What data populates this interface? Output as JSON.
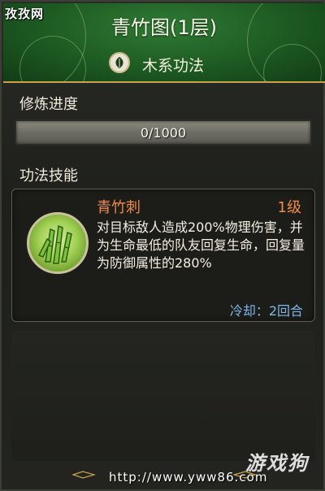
{
  "watermark": {
    "site_name": "孜孜网",
    "url": "http://www.yww86.com",
    "logo_text": "游戏狗"
  },
  "header": {
    "title": "青竹图(1层)",
    "type_label": "木系功法",
    "type_icon": "leaf-icon"
  },
  "progress": {
    "label": "修炼进度",
    "current": 0,
    "max": 1000,
    "text": "0/1000",
    "fraction": 0.0
  },
  "skills": {
    "label": "功法技能",
    "items": [
      {
        "name": "青竹刺",
        "level": "1级",
        "icon": "bamboo-icon",
        "description": "对目标敌人造成200%物理伤害，并为生命最低的队友回复生命，回复量为防御属性的280%",
        "cooldown": "冷却：2回合"
      }
    ]
  },
  "colors": {
    "accent_orange": "#f08a4b",
    "cooldown_blue": "#7fb6e8",
    "header_green": "#1d5a22",
    "gold_trim": "#c8a34a"
  }
}
